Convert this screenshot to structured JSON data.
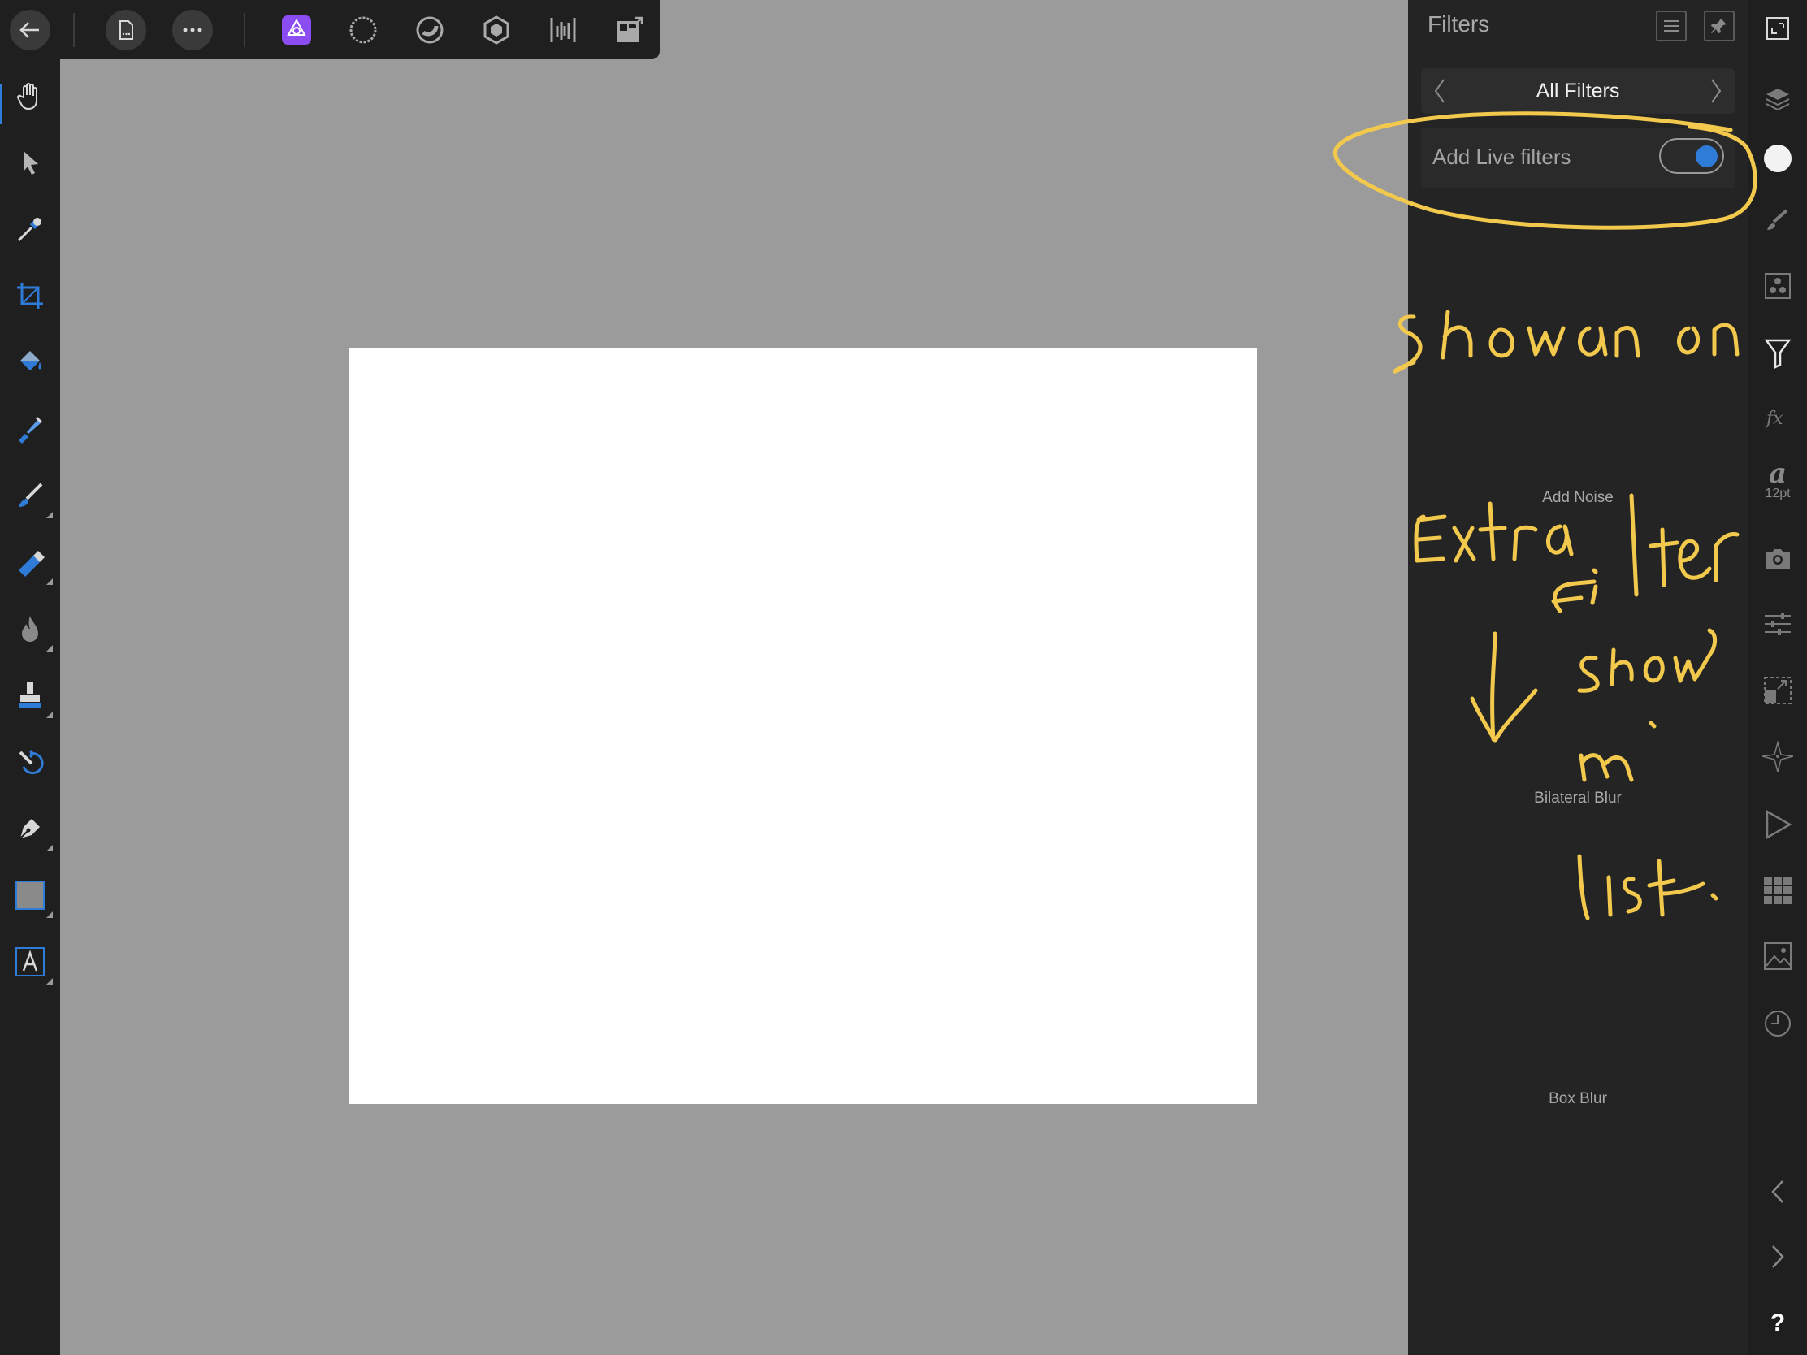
{
  "toolbar": {
    "icons": [
      "back-arrow-icon",
      "document-icon",
      "more-icon",
      "photo-persona-icon",
      "liquify-persona-icon",
      "develop-persona-icon",
      "tone-mapping-persona-icon",
      "export-persona-icon",
      "view-mode-icon"
    ]
  },
  "tools": [
    "view-tool",
    "move-tool",
    "color-picker-tool",
    "crop-tool",
    "flood-fill-tool",
    "selection-brush-tool",
    "paint-brush-tool",
    "erase-brush-tool",
    "dodge-burn-tool",
    "clone-brush-tool",
    "undo-brush-tool",
    "pen-tool",
    "rectangle-tool",
    "text-tool"
  ],
  "panel": {
    "title": "Filters",
    "category": "All Filters",
    "live_filters_label": "Add Live filters",
    "live_filters_on": true,
    "filters": [
      "Add Noise",
      "Bilateral Blur",
      "Box Blur"
    ]
  },
  "studio": {
    "character_label": "a",
    "character_size": "12pt",
    "help": "?"
  },
  "annotation": {
    "color": "#f2c94c"
  },
  "colors": {
    "accent": "#2f7bd8",
    "persona": "#8b4cf2"
  }
}
